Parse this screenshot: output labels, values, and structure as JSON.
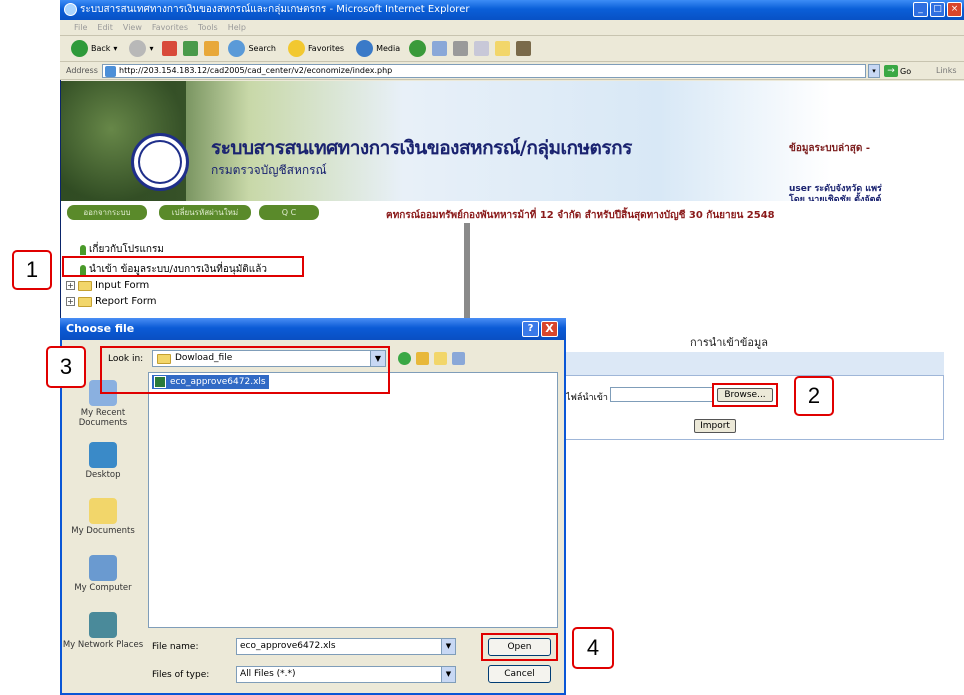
{
  "window": {
    "title": "ระบบสารสนเทศทางการเงินของสหกรณ์และกลุ่มเกษตรกร - Microsoft Internet Explorer",
    "minimize_icon": "minimize-icon",
    "maximize_icon": "maximize-icon",
    "close_icon": "close-icon"
  },
  "menu": [
    "File",
    "Edit",
    "View",
    "Favorites",
    "Tools",
    "Help"
  ],
  "toolbar": {
    "back": "Back",
    "search": "Search",
    "favorites": "Favorites",
    "media": "Media"
  },
  "address": {
    "label": "Address",
    "url": "http://203.154.183.12/cad2005/cad_center/v2/economize/index.php",
    "go": "Go",
    "links": "Links"
  },
  "banner": {
    "title": "ระบบสารสนเทศทางการเงินของสหกรณ์/กลุ่มเกษตรกร",
    "subtitle": "กรมตรวจบัญชีสหกรณ์",
    "latest": "ข้อมูลระบบล่าสุด -",
    "user_line1": "user ระดับจังหวัด แพร่",
    "user_line2": "โดย นายเชิดชัย ตั้งจัตต์"
  },
  "nav": {
    "tabs": [
      "ออกจากระบบ",
      "เปลี่ยนรหัสผ่านใหม่",
      "Q C"
    ],
    "marquee": "ฅทกรณ์ออมทรัพย์กองพันทหารม้าที่ 12 จำกัด สำหรับปีสิ้นสุดทางบัญชี 30 กันยายน 2548"
  },
  "tree": {
    "items": [
      {
        "label": "เกี่ยวกับโปรแกรม",
        "icon": "pin-icon"
      },
      {
        "label": "นำเข้า ข้อมูลระบบ/งบการเงินที่อนุมัติแล้ว",
        "icon": "pin-icon"
      },
      {
        "label": "Input Form",
        "icon": "folder-icon"
      },
      {
        "label": "Report Form",
        "icon": "folder-icon"
      }
    ]
  },
  "import_panel": {
    "title": "การนำเข้าข้อมูล",
    "file_label": "ไฟล์นำเข้า",
    "browse": "Browse...",
    "import": "Import"
  },
  "dialog": {
    "title": "Choose file",
    "help": "?",
    "close": "X",
    "look_in_label": "Look in:",
    "look_in_value": "Dowload_file",
    "file_item": "eco_approve6472.xls",
    "places": [
      "My Recent Documents",
      "Desktop",
      "My Documents",
      "My Computer",
      "My Network Places"
    ],
    "file_name_label": "File name:",
    "file_name_value": "eco_approve6472.xls",
    "file_type_label": "Files of type:",
    "file_type_value": "All Files (*.*)",
    "open": "Open",
    "cancel": "Cancel"
  },
  "callouts": [
    "1",
    "2",
    "3",
    "4"
  ],
  "colors": {
    "callout_red": "#e00000",
    "titlebar_blue": "#0a5fd8",
    "banner_title": "#1a2370",
    "marquee_red": "#8a1a1a",
    "selection": "#316ac5"
  }
}
